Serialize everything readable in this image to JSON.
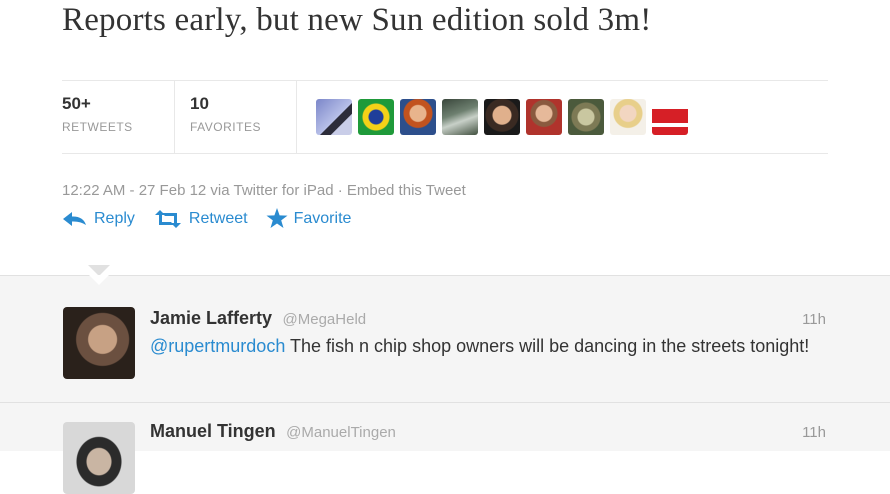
{
  "tweet": {
    "text": "Reports early, but new Sun edition sold 3m!",
    "meta": "12:22 AM - 27 Feb 12 via Twitter for iPad · Embed this Tweet"
  },
  "stats": {
    "retweets_count": "50+",
    "retweets_label": "RETWEETS",
    "favorites_count": "10",
    "favorites_label": "FAVORITES"
  },
  "actions": {
    "reply": "Reply",
    "retweet": "Retweet",
    "favorite": "Favorite"
  },
  "replies": [
    {
      "name": "Jamie Lafferty",
      "handle": "@MegaHeld",
      "time": "11h",
      "mention": "@rupertmurdoch",
      "text": " The fish n chip shop owners will be dancing in the streets tonight!"
    },
    {
      "name": "Manuel Tingen",
      "handle": "@ManuelTingen",
      "time": "11h"
    }
  ],
  "colors": {
    "link": "#2a8bd0",
    "muted": "#999999",
    "reply_bg": "#f5f5f5"
  }
}
